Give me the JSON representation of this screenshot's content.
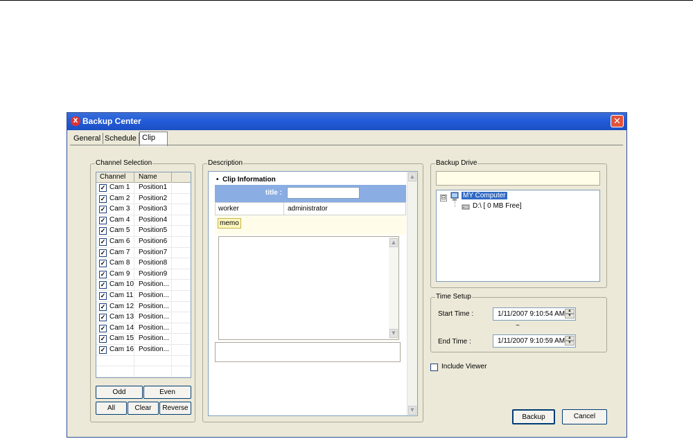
{
  "window": {
    "title": "Backup Center",
    "close_glyph": "✕",
    "icon": "app-logo-icon"
  },
  "tabs": [
    {
      "label": "General",
      "active": false
    },
    {
      "label": "Schedule",
      "active": false
    },
    {
      "label": "Clip",
      "active": true
    }
  ],
  "channel_selection": {
    "label": "Channel Selection",
    "headers": {
      "channel": "Channel",
      "name": "Name"
    },
    "rows": [
      {
        "cam": "Cam 1",
        "name": "Position1",
        "checked": true
      },
      {
        "cam": "Cam 2",
        "name": "Position2",
        "checked": true
      },
      {
        "cam": "Cam 3",
        "name": "Position3",
        "checked": true
      },
      {
        "cam": "Cam 4",
        "name": "Position4",
        "checked": true
      },
      {
        "cam": "Cam 5",
        "name": "Position5",
        "checked": true
      },
      {
        "cam": "Cam 6",
        "name": "Position6",
        "checked": true
      },
      {
        "cam": "Cam 7",
        "name": "Position7",
        "checked": true
      },
      {
        "cam": "Cam 8",
        "name": "Position8",
        "checked": true
      },
      {
        "cam": "Cam 9",
        "name": "Position9",
        "checked": true
      },
      {
        "cam": "Cam 10",
        "name": "Position...",
        "checked": true
      },
      {
        "cam": "Cam 11",
        "name": "Position...",
        "checked": true
      },
      {
        "cam": "Cam 12",
        "name": "Position...",
        "checked": true
      },
      {
        "cam": "Cam 13",
        "name": "Position...",
        "checked": true
      },
      {
        "cam": "Cam 14",
        "name": "Position...",
        "checked": true
      },
      {
        "cam": "Cam 15",
        "name": "Position...",
        "checked": true
      },
      {
        "cam": "Cam 16",
        "name": "Position...",
        "checked": true
      }
    ],
    "buttons": {
      "odd": "Odd",
      "even": "Even",
      "all": "All",
      "clear": "Clear",
      "reverse": "Reverse"
    }
  },
  "description": {
    "label": "Description",
    "bullet": "•",
    "heading": "Clip Information",
    "title_label": "title :",
    "title_value": "",
    "worker_label": "worker",
    "worker_value": "administrator",
    "memo_label": "memo",
    "memo_value": ""
  },
  "backup_drive": {
    "label": "Backup Drive",
    "selected_path": "",
    "tree": {
      "root": "MY Computer",
      "root_expander": "⊟",
      "drive": "D:\\ [ 0 MB Free]"
    }
  },
  "time_setup": {
    "label": "Time Setup",
    "start_label": "Start Time :",
    "start_value": "1/11/2007   9:10:54 AM",
    "separator": "~",
    "end_label": "End Time :",
    "end_value": "1/11/2007   9:10:59 AM"
  },
  "include_viewer": {
    "label": "Include Viewer",
    "checked": false
  },
  "actions": {
    "backup": "Backup",
    "cancel": "Cancel"
  },
  "colors": {
    "titlebar": "#245edb",
    "dialog_bg": "#ece9d8",
    "selection": "#316ac5",
    "title_band": "#8aaee3"
  }
}
